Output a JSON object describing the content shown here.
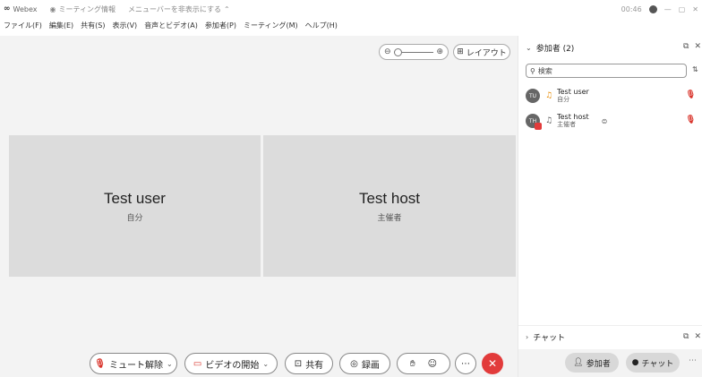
{
  "titlebar": {
    "app_name": "Webex",
    "meeting_info": "ミーティング情報",
    "hide_menu": "メニューバーを非表示にする",
    "timer": "00:46"
  },
  "menu": [
    "ファイル(F)",
    "編集(E)",
    "共有(S)",
    "表示(V)",
    "音声とビデオ(A)",
    "参加者(P)",
    "ミーティング(M)",
    "ヘルプ(H)"
  ],
  "stage": {
    "layout_label": "レイアウト",
    "zoom_level": 0.0,
    "tiles": [
      {
        "name": "Test user",
        "role": "自分"
      },
      {
        "name": "Test host",
        "role": "主催者"
      }
    ]
  },
  "controls": {
    "unmute": "ミュート解除",
    "start_video": "ビデオの開始",
    "share": "共有",
    "record": "録画"
  },
  "panel": {
    "participants_title": "参加者 (2)",
    "search_placeholder": "検索",
    "participants": [
      {
        "initials": "TU",
        "name": "Test user",
        "role": "自分"
      },
      {
        "initials": "TH",
        "name": "Test host",
        "role": "主催者"
      }
    ],
    "chat_title": "チャット",
    "footer_participants": "参加者",
    "footer_chat": "チャット"
  },
  "colors": {
    "leave_red": "#e23b3b",
    "stage_bg": "#f3f3f3",
    "tile_bg": "#dcdcdc"
  }
}
